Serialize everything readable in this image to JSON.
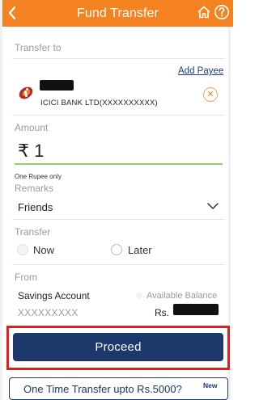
{
  "header": {
    "title": "Fund Transfer",
    "back_icon": "chevron-left-icon",
    "home_icon": "home-icon",
    "help_icon": "help-icon",
    "color": "#f58220"
  },
  "transfer_to": {
    "label": "Transfer to",
    "add_payee": "Add Payee",
    "payee_bank_text": "ICICI BANK LTD(XXXXXXXXXX)"
  },
  "amount": {
    "label": "Amount",
    "value": "₹ 1",
    "words": "One Rupee only"
  },
  "remarks": {
    "label": "Remarks",
    "value": "Friends"
  },
  "transfer": {
    "label": "Transfer",
    "options": [
      {
        "label": "Now",
        "selected": true
      },
      {
        "label": "Later",
        "selected": false
      }
    ]
  },
  "from": {
    "label": "From",
    "account_type": "Savings Account",
    "available_balance_label": "Available Balance",
    "account_number": "XXXXXXXXX",
    "currency": "Rs."
  },
  "actions": {
    "proceed": "Proceed",
    "one_time_transfer": "One Time Transfer upto Rs.5000?",
    "new_tag": "New"
  },
  "colors": {
    "brand_orange": "#f58220",
    "navy": "#1d386b",
    "highlight_red": "#e0201f",
    "input_focus": "#8cd36f"
  }
}
